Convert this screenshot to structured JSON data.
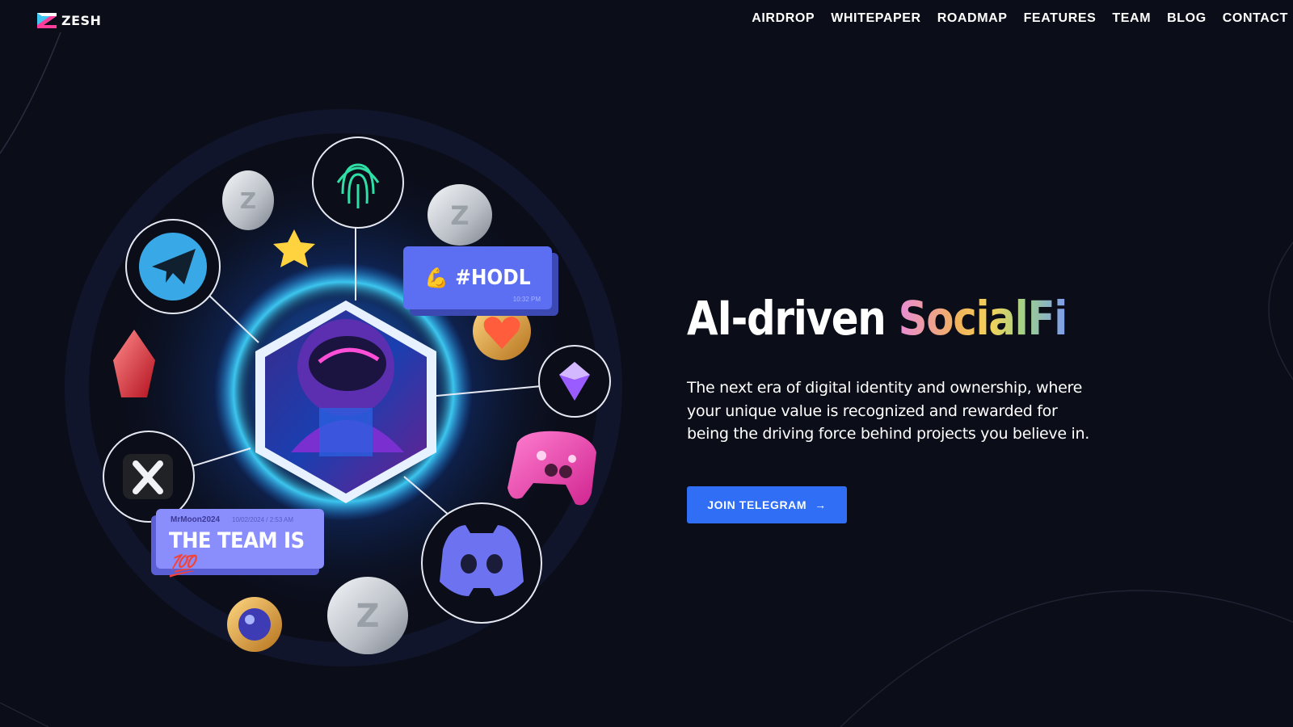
{
  "brand": {
    "name": "ZESH",
    "colors": {
      "logo_cyan": "#3fc5f0",
      "logo_magenta": "#ff3d9a"
    }
  },
  "nav": {
    "items": [
      {
        "label": "AIRDROP"
      },
      {
        "label": "WHITEPAPER"
      },
      {
        "label": "ROADMAP"
      },
      {
        "label": "FEATURES"
      },
      {
        "label": "TEAM"
      },
      {
        "label": "BLOG"
      },
      {
        "label": "CONTACT"
      }
    ]
  },
  "hero": {
    "title_main": "AI-driven",
    "title_accent": "SocialFi",
    "description": "The next era of digital identity and ownership, where your unique value is recognized and rewarded for being the driving force behind projects you believe in.",
    "cta_label": "JOIN TELEGRAM",
    "cta_icon": "arrow-right-icon",
    "cta_color": "#2f6ef5"
  },
  "illustration": {
    "hashtag_card": {
      "text": "#HODL",
      "time": "10:32 PM",
      "emoji": "💪"
    },
    "team_card": {
      "user": "MrMoon2024",
      "date": "10/02/2024 / 2:53 AM",
      "text": "THE TEAM IS",
      "emoji": "💯"
    },
    "icons": [
      "telegram-icon",
      "fingerprint-icon",
      "x-icon",
      "discord-icon",
      "gamepad-icon",
      "gem-icon",
      "heart-badge-icon",
      "star-icon",
      "coin-icon",
      "crystal-icon",
      "orb-icon",
      "avatar"
    ]
  },
  "background": "#0b0d18"
}
